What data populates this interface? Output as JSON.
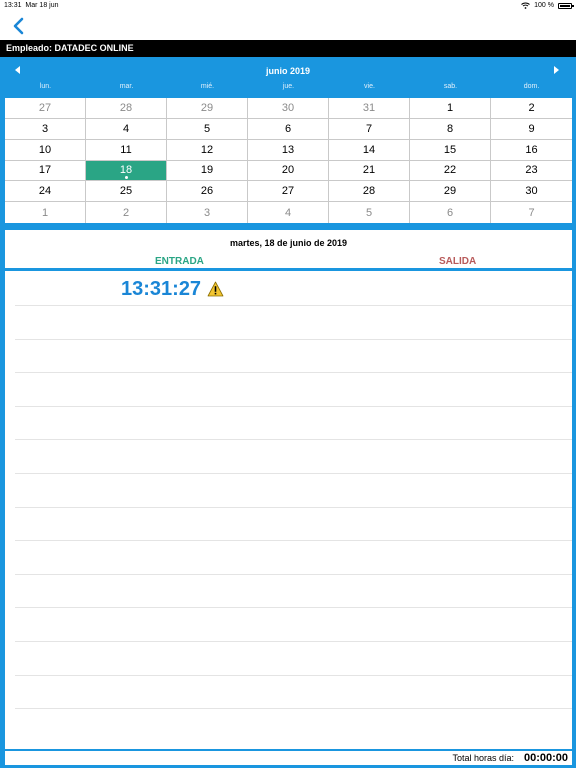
{
  "status_bar": {
    "time": "13:31",
    "date": "Mar 18 jun",
    "battery": "100 %"
  },
  "nav": {
    "back_icon": "chevron-left-icon"
  },
  "employee": {
    "label": "Empleado: DATADEC ONLINE"
  },
  "calendar": {
    "month_title": "junio 2019",
    "weekdays": [
      "lun.",
      "mar.",
      "mié.",
      "jue.",
      "vie.",
      "sab.",
      "dom."
    ],
    "weeks": [
      [
        {
          "d": "27",
          "m": true
        },
        {
          "d": "28",
          "m": true
        },
        {
          "d": "29",
          "m": true
        },
        {
          "d": "30",
          "m": true
        },
        {
          "d": "31",
          "m": true
        },
        {
          "d": "1"
        },
        {
          "d": "2"
        }
      ],
      [
        {
          "d": "3"
        },
        {
          "d": "4"
        },
        {
          "d": "5"
        },
        {
          "d": "6"
        },
        {
          "d": "7"
        },
        {
          "d": "8"
        },
        {
          "d": "9"
        }
      ],
      [
        {
          "d": "10"
        },
        {
          "d": "11"
        },
        {
          "d": "12"
        },
        {
          "d": "13"
        },
        {
          "d": "14"
        },
        {
          "d": "15"
        },
        {
          "d": "16"
        }
      ],
      [
        {
          "d": "17"
        },
        {
          "d": "18",
          "sel": true
        },
        {
          "d": "19"
        },
        {
          "d": "20"
        },
        {
          "d": "21"
        },
        {
          "d": "22"
        },
        {
          "d": "23"
        }
      ],
      [
        {
          "d": "24"
        },
        {
          "d": "25"
        },
        {
          "d": "26"
        },
        {
          "d": "27"
        },
        {
          "d": "28"
        },
        {
          "d": "29"
        },
        {
          "d": "30"
        }
      ],
      [
        {
          "d": "1",
          "m": true
        },
        {
          "d": "2",
          "m": true
        },
        {
          "d": "3",
          "m": true
        },
        {
          "d": "4",
          "m": true
        },
        {
          "d": "5",
          "m": true
        },
        {
          "d": "6",
          "m": true
        },
        {
          "d": "7",
          "m": true
        }
      ]
    ]
  },
  "day": {
    "title": "martes, 18 de junio de 2019",
    "entrada_label": "ENTRADA",
    "salida_label": "SALIDA"
  },
  "records": {
    "entry_time": "13:31:27",
    "warning_icon": "warning-icon"
  },
  "footer": {
    "total_label": "Total horas día:",
    "total_value": "00:00:00"
  },
  "colors": {
    "accent": "#1a96df",
    "selected": "#2aa585",
    "entrada": "#2aa585",
    "salida": "#b85a5a",
    "time": "#1a86d6"
  }
}
